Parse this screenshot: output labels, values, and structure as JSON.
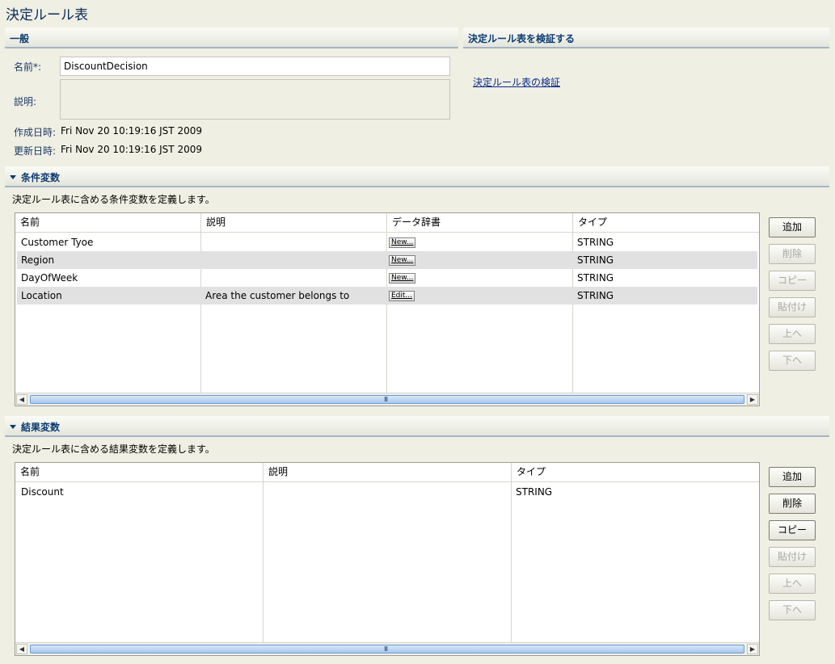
{
  "page_title": "決定ルール表",
  "general": {
    "header": "一般",
    "name_label": "名前*:",
    "name_value": "DiscountDecision",
    "desc_label": "説明:",
    "created_label": "作成日時:",
    "created_value": "Fri Nov 20 10:19:16 JST 2009",
    "updated_label": "更新日時:",
    "updated_value": "Fri Nov 20 10:19:16 JST 2009"
  },
  "verify": {
    "header": "決定ルール表を検証する",
    "link": "決定ルール表の検証"
  },
  "conditions": {
    "header": "条件変数",
    "description": "決定ルール表に含める条件変数を定義します。",
    "columns": [
      "名前",
      "説明",
      "データ辞書",
      "タイプ"
    ],
    "rows": [
      {
        "name": "Customer Tyoe",
        "desc": "",
        "dict": "New...",
        "type": "STRING"
      },
      {
        "name": "Region",
        "desc": "",
        "dict": "New...",
        "type": "STRING"
      },
      {
        "name": "DayOfWeek",
        "desc": "",
        "dict": "New...",
        "type": "STRING"
      },
      {
        "name": "Location",
        "desc": "Area the customer belongs to",
        "dict": "Edit...",
        "type": "STRING"
      }
    ],
    "buttons": {
      "add": "追加",
      "delete": "削除",
      "copy": "コピー",
      "paste": "貼付け",
      "up": "上へ",
      "down": "下へ"
    }
  },
  "results": {
    "header": "結果変数",
    "description": "決定ルール表に含める結果変数を定義します。",
    "columns": [
      "名前",
      "説明",
      "タイプ"
    ],
    "rows": [
      {
        "name": "Discount",
        "desc": "",
        "type": "STRING"
      }
    ],
    "buttons": {
      "add": "追加",
      "delete": "削除",
      "copy": "コピー",
      "paste": "貼付け",
      "up": "上へ",
      "down": "下へ"
    }
  },
  "scroll_grip": "III",
  "icons": {
    "collapse": "triangle-down-icon",
    "scroll_left": "arrow-left-icon",
    "scroll_right": "arrow-right-icon"
  },
  "colors": {
    "header_text": "#0c3b72",
    "link": "#0b2a8a",
    "background": "#efefe3",
    "alt_row": "#e1e1e1"
  }
}
